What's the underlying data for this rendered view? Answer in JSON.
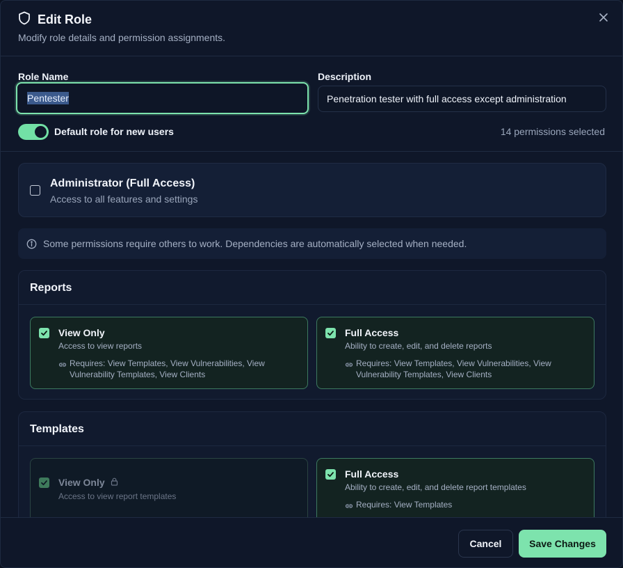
{
  "dialog": {
    "title": "Edit Role",
    "subtitle": "Modify role details and permission assignments.",
    "close_icon": "close-icon",
    "title_icon": "shield-icon"
  },
  "form": {
    "role_name_label": "Role Name",
    "role_name_value": "Pentester",
    "description_label": "Description",
    "description_value": "Penetration tester with full access except administration",
    "default_toggle_label": "Default role for new users",
    "default_toggle_on": true,
    "permissions_count": "14 permissions selected"
  },
  "admin": {
    "title": "Administrator (Full Access)",
    "subtitle": "Access to all features and settings",
    "checked": false
  },
  "info": {
    "text": "Some permissions require others to work. Dependencies are automatically selected when needed."
  },
  "sections": [
    {
      "title": "Reports",
      "cards": [
        {
          "title": "View Only",
          "subtitle": "Access to view reports",
          "requires": "Requires: View Templates, View Vulnerabilities, View Vulnerability Templates, View Clients",
          "checked": true,
          "locked": false
        },
        {
          "title": "Full Access",
          "subtitle": "Ability to create, edit, and delete reports",
          "requires": "Requires: View Templates, View Vulnerabilities, View Vulnerability Templates, View Clients",
          "checked": true,
          "locked": false
        }
      ]
    },
    {
      "title": "Templates",
      "cards": [
        {
          "title": "View Only",
          "subtitle": "Access to view report templates",
          "requires": "",
          "checked": true,
          "locked": true
        },
        {
          "title": "Full Access",
          "subtitle": "Ability to create, edit, and delete report templates",
          "requires": "Requires: View Templates",
          "checked": true,
          "locked": false
        }
      ]
    }
  ],
  "footer": {
    "cancel_label": "Cancel",
    "save_label": "Save Changes"
  },
  "colors": {
    "accent": "#7de3ad",
    "background": "#0f1729"
  }
}
